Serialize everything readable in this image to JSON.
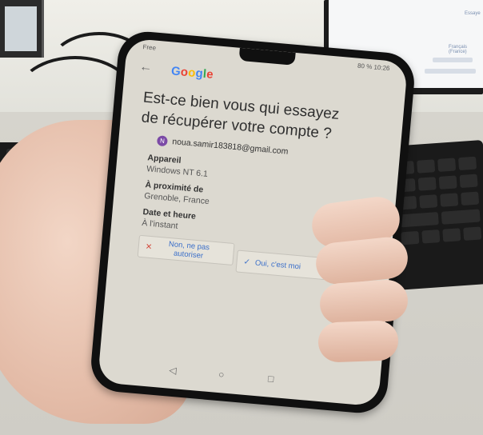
{
  "background": {
    "monitor_text": "Essaye",
    "monitor_text_2": "Français (France)"
  },
  "phone": {
    "status_bar": {
      "left": "Free",
      "right": "80 %  10:26"
    },
    "top_bar": {
      "back_icon": "back-arrow-icon",
      "logo_letters": [
        "G",
        "o",
        "o",
        "g",
        "l",
        "e"
      ]
    },
    "prompt": {
      "headline_line1": "Est-ce bien vous qui essayez",
      "headline_line2": "de récupérer votre compte ?",
      "avatar_letter": "N",
      "account_email": "noua.samir183818@gmail.com"
    },
    "details": [
      {
        "label": "Appareil",
        "value": "Windows NT 6.1"
      },
      {
        "label": "À proximité de",
        "value": "Grenoble, France"
      },
      {
        "label": "Date et heure",
        "value": "À l'instant"
      }
    ],
    "buttons": {
      "deny_icon": "close-icon",
      "deny_label": "Non, ne pas autoriser",
      "allow_icon": "check-icon",
      "allow_label": "Oui, c'est moi"
    },
    "nav": {
      "back_icon": "nav-back-icon",
      "home_icon": "nav-home-icon",
      "recent_icon": "nav-recent-icon"
    }
  },
  "colors": {
    "google_blue": "#4285f4",
    "google_red": "#ea4335",
    "google_yellow": "#fbbc05",
    "google_green": "#34a853",
    "button_text": "#3b6fc9",
    "deny_icon": "#d44b3d"
  }
}
